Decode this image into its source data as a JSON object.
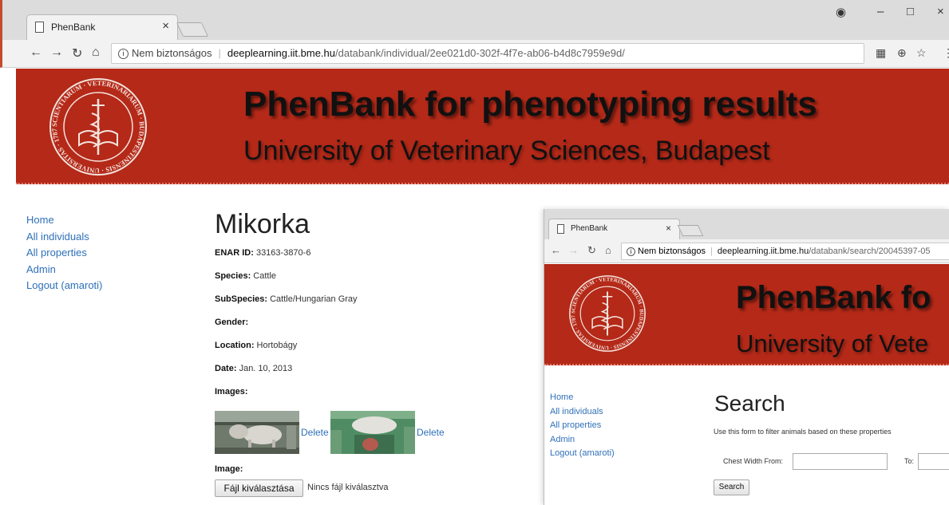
{
  "browser": {
    "tab_title": "PhenBank",
    "url_security": "Nem biztonságos",
    "url_host": "deeplearning.iit.bme.hu",
    "url_path": "/databank/individual/2ee021d0-302f-4f7e-ab06-b4d8c7959e9d/"
  },
  "banner": {
    "title": "PhenBank for phenotyping results",
    "subtitle": "University of Veterinary Sciences, Budapest",
    "seal_text": "SCIENTIARUM · VETERINARIARUM · BUDAPESTINENSIS · UNIVERSITAS · 1787",
    "seal_year": "1787"
  },
  "sidebar": {
    "items": [
      "Home",
      "All individuals",
      "All properties",
      "Admin",
      "Logout (amaroti)"
    ]
  },
  "individual": {
    "name": "Mikorka",
    "fields": [
      {
        "label": "ENAR ID:",
        "value": " 33163-3870-6"
      },
      {
        "label": "Species:",
        "value": " Cattle"
      },
      {
        "label": "SubSpecies:",
        "value": " Cattle/Hungarian Gray"
      },
      {
        "label": "Gender:",
        "value": ""
      },
      {
        "label": "Location:",
        "value": " Hortobágy"
      },
      {
        "label": "Date:",
        "value": " Jan. 10, 2013"
      }
    ],
    "images_label": "Images:",
    "delete_label": "Delete",
    "image_label": "Image:",
    "file_button": "Fájl kiválasztása",
    "file_status": "Nincs fájl kiválasztva"
  },
  "overlay": {
    "tab_title": "PhenBank",
    "url_security": "Nem biztonságos",
    "url_host": "deeplearning.iit.bme.hu",
    "url_path": "/databank/search/20045397-05",
    "banner_title": "PhenBank fo",
    "banner_subtitle": "University of Vete",
    "sidebar": [
      "Home",
      "All individuals",
      "All properties",
      "Admin",
      "Logout (amaroti)"
    ],
    "heading": "Search",
    "description": "Use this form to filter animals based on these properties",
    "from_label": "Chest Width From:",
    "to_label": "To:",
    "search_button": "Search"
  },
  "colors": {
    "banner_red": "#b42918",
    "link_blue": "#2f70b8"
  }
}
